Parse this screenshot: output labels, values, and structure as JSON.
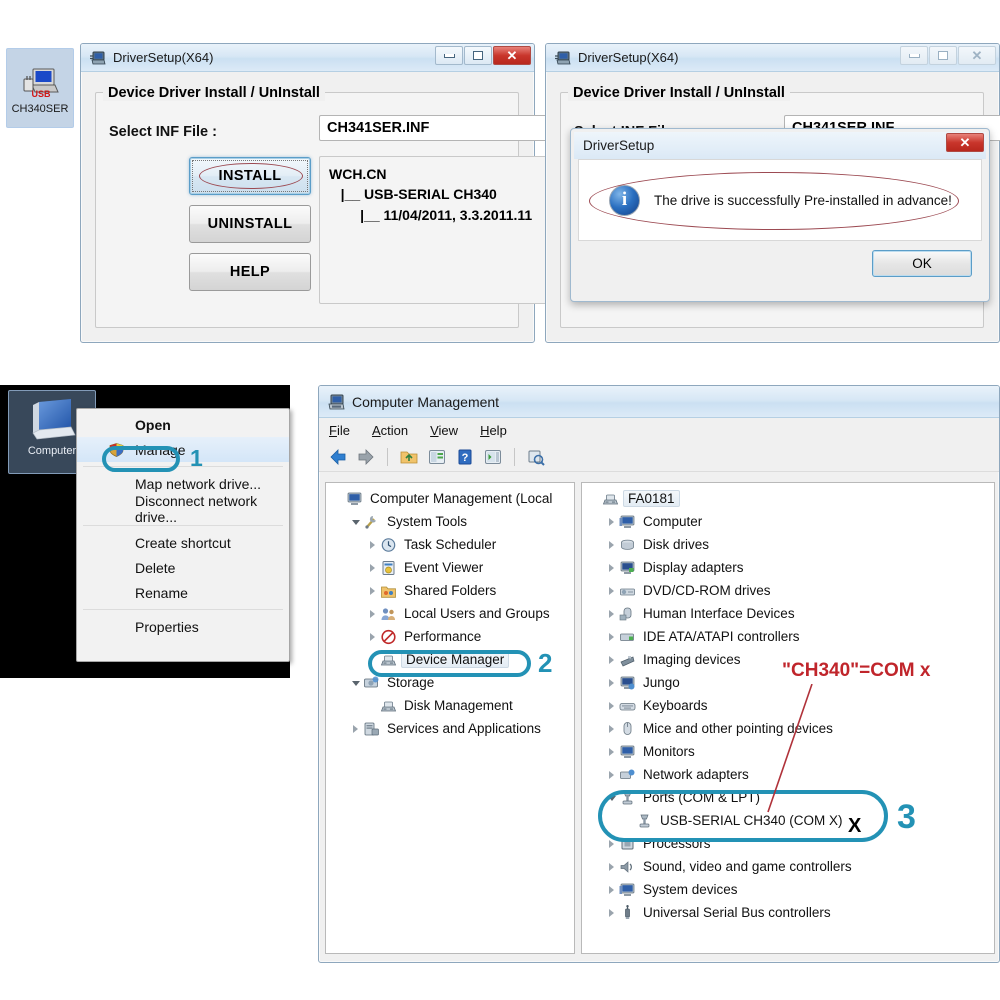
{
  "desktop_icon": {
    "label": "CH340SER",
    "icon": "usb-driver-icon"
  },
  "driver_window_1": {
    "title": "DriverSetup(X64)",
    "icon": "driver-setup-icon",
    "controls": {
      "minimize": "–",
      "maximize": "□",
      "close": "✕"
    },
    "group_title": "Device Driver Install / UnInstall",
    "inf_label": "Select INF File :",
    "inf_value": "CH341SER.INF",
    "buttons": {
      "install": "INSTALL",
      "uninstall": "UNINSTALL",
      "help": "HELP"
    },
    "info_text": "WCH.CN\n   |__ USB-SERIAL CH340\n        |__ 11/04/2011, 3.3.2011.11"
  },
  "driver_window_2": {
    "title": "DriverSetup(X64)",
    "icon": "driver-setup-icon",
    "group_title": "Device Driver Install / UnInstall",
    "inf_label": "Select INF File :",
    "inf_value": "CH341SER.INF"
  },
  "message_dialog": {
    "title": "DriverSetup",
    "close_label": "✕",
    "icon": "info-icon",
    "message": "The drive is successfully Pre-installed in advance!",
    "ok_label": "OK"
  },
  "context_menu": {
    "computer_label": "Computer",
    "items": [
      {
        "label": "Open",
        "bold": true,
        "shield": false,
        "selected": false
      },
      {
        "label": "Manage",
        "bold": false,
        "shield": true,
        "selected": true
      },
      {
        "separator": true
      },
      {
        "label": "Map network drive...",
        "bold": false,
        "shield": false,
        "selected": false
      },
      {
        "label": "Disconnect network drive...",
        "bold": false,
        "shield": false,
        "selected": false
      },
      {
        "separator": true
      },
      {
        "label": "Create shortcut",
        "bold": false,
        "shield": false,
        "selected": false
      },
      {
        "label": "Delete",
        "bold": false,
        "shield": false,
        "selected": false
      },
      {
        "label": "Rename",
        "bold": false,
        "shield": false,
        "selected": false
      },
      {
        "separator": true
      },
      {
        "label": "Properties",
        "bold": false,
        "shield": false,
        "selected": false
      }
    ]
  },
  "computer_management": {
    "title": "Computer Management",
    "icon": "computer-management-icon",
    "menu": [
      {
        "label": "File",
        "accel": "F"
      },
      {
        "label": "Action",
        "accel": "A"
      },
      {
        "label": "View",
        "accel": "V"
      },
      {
        "label": "Help",
        "accel": "H"
      }
    ],
    "toolbar_icons": [
      "back-arrow-icon",
      "forward-arrow-icon",
      "up-folder-icon",
      "show-hide-console-tree-icon",
      "help-icon",
      "show-action-pane-icon",
      "properties-icon"
    ],
    "left_tree": [
      {
        "label": "Computer Management (Local",
        "depth": 0,
        "twisty": "none",
        "icon": "computer-management-icon",
        "selected": false
      },
      {
        "label": "System Tools",
        "depth": 1,
        "twisty": "open",
        "icon": "system-tools-icon",
        "selected": false
      },
      {
        "label": "Task Scheduler",
        "depth": 2,
        "twisty": "closed",
        "icon": "clock-icon",
        "selected": false
      },
      {
        "label": "Event Viewer",
        "depth": 2,
        "twisty": "closed",
        "icon": "event-viewer-icon",
        "selected": false
      },
      {
        "label": "Shared Folders",
        "depth": 2,
        "twisty": "closed",
        "icon": "shared-folders-icon",
        "selected": false
      },
      {
        "label": "Local Users and Groups",
        "depth": 2,
        "twisty": "closed",
        "icon": "users-icon",
        "selected": false
      },
      {
        "label": "Performance",
        "depth": 2,
        "twisty": "closed",
        "icon": "performance-icon",
        "selected": false
      },
      {
        "label": "Device Manager",
        "depth": 2,
        "twisty": "none",
        "icon": "device-manager-icon",
        "selected": true
      },
      {
        "label": "Storage",
        "depth": 1,
        "twisty": "open",
        "icon": "storage-icon",
        "selected": false
      },
      {
        "label": "Disk Management",
        "depth": 2,
        "twisty": "none",
        "icon": "disk-management-icon",
        "selected": false
      },
      {
        "label": "Services and Applications",
        "depth": 1,
        "twisty": "closed",
        "icon": "services-icon",
        "selected": false
      }
    ],
    "right_tree": [
      {
        "label": "FA0181",
        "depth": 0,
        "twisty": "none",
        "icon": "computer-node-icon",
        "selected": true
      },
      {
        "label": "Computer",
        "depth": 1,
        "twisty": "closed",
        "icon": "computer-icon",
        "selected": false
      },
      {
        "label": "Disk drives",
        "depth": 1,
        "twisty": "closed",
        "icon": "disk-drive-icon",
        "selected": false
      },
      {
        "label": "Display adapters",
        "depth": 1,
        "twisty": "closed",
        "icon": "display-adapter-icon",
        "selected": false
      },
      {
        "label": "DVD/CD-ROM drives",
        "depth": 1,
        "twisty": "closed",
        "icon": "dvd-drive-icon",
        "selected": false
      },
      {
        "label": "Human Interface Devices",
        "depth": 1,
        "twisty": "closed",
        "icon": "hid-icon",
        "selected": false
      },
      {
        "label": "IDE ATA/ATAPI controllers",
        "depth": 1,
        "twisty": "closed",
        "icon": "ide-controller-icon",
        "selected": false
      },
      {
        "label": "Imaging devices",
        "depth": 1,
        "twisty": "closed",
        "icon": "imaging-device-icon",
        "selected": false
      },
      {
        "label": "Jungo",
        "depth": 1,
        "twisty": "closed",
        "icon": "jungo-icon",
        "selected": false
      },
      {
        "label": "Keyboards",
        "depth": 1,
        "twisty": "closed",
        "icon": "keyboard-icon",
        "selected": false
      },
      {
        "label": "Mice and other pointing devices",
        "depth": 1,
        "twisty": "closed",
        "icon": "mouse-icon",
        "selected": false
      },
      {
        "label": "Monitors",
        "depth": 1,
        "twisty": "closed",
        "icon": "monitor-icon",
        "selected": false
      },
      {
        "label": "Network adapters",
        "depth": 1,
        "twisty": "closed",
        "icon": "network-adapter-icon",
        "selected": false
      },
      {
        "label": "Ports (COM & LPT)",
        "depth": 1,
        "twisty": "open",
        "icon": "port-icon",
        "selected": false
      },
      {
        "label": "USB-SERIAL CH340 (COM X)",
        "depth": 2,
        "twisty": "none",
        "icon": "port-icon",
        "selected": false
      },
      {
        "label": "Processors",
        "depth": 1,
        "twisty": "closed",
        "icon": "processor-icon",
        "selected": false
      },
      {
        "label": "Sound, video and game controllers",
        "depth": 1,
        "twisty": "closed",
        "icon": "sound-icon",
        "selected": false
      },
      {
        "label": "System devices",
        "depth": 1,
        "twisty": "closed",
        "icon": "system-device-icon",
        "selected": false
      },
      {
        "label": "Universal Serial Bus controllers",
        "depth": 1,
        "twisty": "closed",
        "icon": "usb-controller-icon",
        "selected": false
      }
    ]
  },
  "annotations": {
    "step1": "1",
    "step2": "2",
    "step3": "3",
    "com_note": "\"CH340\"=COM x",
    "x_mark": "X",
    "accent_teal": "#2392b5",
    "accent_red": "#c0252b",
    "ellipse_red": "#9c4a52"
  }
}
